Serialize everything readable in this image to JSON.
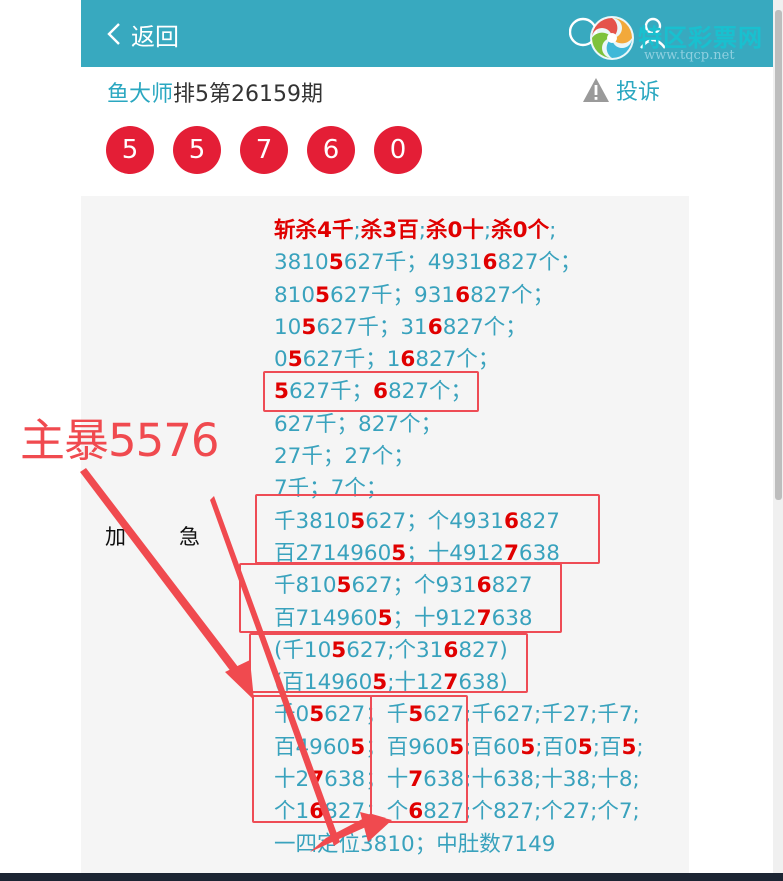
{
  "header": {
    "back_label": "返回",
    "watermark_name": "特区彩票网",
    "watermark_url": "www.tqcp.net",
    "bg_color": "#38a9bf"
  },
  "title": {
    "master": "鱼大师",
    "rest": "排5第26159期",
    "report_label": "投诉"
  },
  "balls": [
    "5",
    "5",
    "7",
    "6",
    "0"
  ],
  "side_label": [
    "加",
    "急"
  ],
  "content": {
    "headline": [
      {
        "t": "斩杀4千",
        "red": true
      },
      {
        "t": ";",
        "red": false
      },
      {
        "t": "杀3百",
        "red": true
      },
      {
        "t": ";",
        "red": false
      },
      {
        "t": "杀0十",
        "red": true
      },
      {
        "t": ";",
        "red": false
      },
      {
        "t": "杀0个",
        "red": true
      },
      {
        "t": ";",
        "red": false
      }
    ],
    "lines": [
      [
        "3810",
        "5",
        "627千；4931",
        "6",
        "827个；"
      ],
      [
        "810",
        "5",
        "627千；931",
        "6",
        "827个；"
      ],
      [
        "10",
        "5",
        "627千；31",
        "6",
        "827个；"
      ],
      [
        "0",
        "5",
        "627千；1",
        "6",
        "827个；"
      ],
      [
        "",
        "5",
        "627千；",
        "6",
        "827个；"
      ],
      [
        "627千；827个；"
      ],
      [
        "27千；27个；"
      ],
      [
        "7千；7个；"
      ],
      [
        "千3810",
        "5",
        "627；个4931",
        "6",
        "827"
      ],
      [
        "百2714960",
        "5",
        "；十4912",
        "7",
        "638"
      ],
      [
        "千810",
        "5",
        "627；个931",
        "6",
        "827"
      ],
      [
        "百714960",
        "5",
        "；十912",
        "7",
        "638"
      ],
      [
        "(千10",
        "5",
        "627;个31",
        "6",
        "827)"
      ],
      [
        "(百14960",
        "5",
        ";十12",
        "7",
        "638)"
      ],
      [
        "千0",
        "5",
        "627；千",
        "5",
        "627;千627;千27;千7;"
      ],
      [
        "百4960",
        "5",
        "；百960",
        "5",
        ";百60",
        "5",
        ";百0",
        "5",
        ";百",
        "5",
        ";"
      ],
      [
        "十2",
        "7",
        "638；十",
        "7",
        "638;十638;十38;十8;"
      ],
      [
        "个1",
        "6",
        "827；个",
        "6",
        "827;个827;个27;个7;"
      ],
      [
        "一四定位3810；中肚数7149"
      ]
    ]
  },
  "annotation": "主暴5576",
  "colors": {
    "ball": "#e41e36",
    "text_blue": "#39a2bd",
    "text_red": "#e00000",
    "annotation": "#f04a4f"
  }
}
